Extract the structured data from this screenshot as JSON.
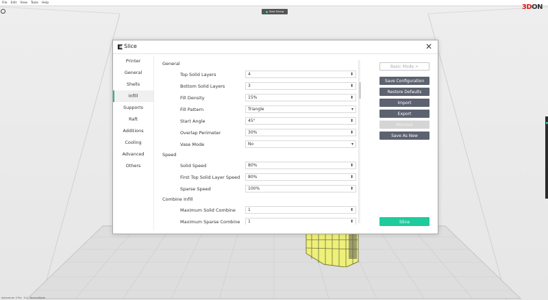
{
  "app": {
    "menu": [
      "File",
      "Edit",
      "View",
      "Tools",
      "Help"
    ],
    "brand": {
      "main": "3D",
      "suffix": "ON"
    },
    "slicing_pill": "Start Slicing",
    "status": "Adventurer 4 Pro · 0.4 · NormalMode"
  },
  "dialog": {
    "title": "Slice",
    "close": "✕",
    "nav": [
      {
        "label": "Printer"
      },
      {
        "label": "General"
      },
      {
        "label": "Shells"
      },
      {
        "label": "Infill",
        "active": true
      },
      {
        "label": "Supports"
      },
      {
        "label": "Raft"
      },
      {
        "label": "Additions"
      },
      {
        "label": "Cooling"
      },
      {
        "label": "Advanced"
      },
      {
        "label": "Others"
      }
    ],
    "sections": [
      {
        "title": "General",
        "rows": [
          {
            "label": "Top Solid Layers",
            "value": "4",
            "control": "spin"
          },
          {
            "label": "Bottom Solid Layers",
            "value": "3",
            "control": "spin"
          },
          {
            "label": "Fill Density",
            "value": "15%",
            "control": "spin"
          },
          {
            "label": "Fill Pattern",
            "value": "Triangle",
            "control": "dropdown"
          },
          {
            "label": "Start Angle",
            "value": "45°",
            "control": "spin"
          },
          {
            "label": "Overlap Perimeter",
            "value": "30%",
            "control": "spin"
          },
          {
            "label": "Vase Mode",
            "value": "No",
            "control": "dropdown"
          }
        ]
      },
      {
        "title": "Speed",
        "rows": [
          {
            "label": "Solid Speed",
            "value": "80%",
            "control": "spin"
          },
          {
            "label": "First Top Solid Layer Speed",
            "value": "80%",
            "control": "spin"
          },
          {
            "label": "Sparse Speed",
            "value": "100%",
            "control": "spin"
          }
        ]
      },
      {
        "title": "Combine Infill",
        "rows": [
          {
            "label": "Maximum Solid Combine",
            "value": "1",
            "control": "spin"
          },
          {
            "label": "Maximum Sparse Combine",
            "value": "1",
            "control": "spin"
          }
        ]
      }
    ],
    "actions": {
      "basic_mode": "Basic Mode >",
      "save_configuration": "Save Configuration",
      "restore_defaults": "Restore Defaults",
      "import": "Import",
      "export": "Export",
      "remove": "Remove",
      "save_as_new": "Save As New"
    },
    "slice_button": "Slice"
  },
  "colors": {
    "accent": "#1dcb9c",
    "button_dark": "#5d6270",
    "model_yellow": "#eef07a"
  }
}
